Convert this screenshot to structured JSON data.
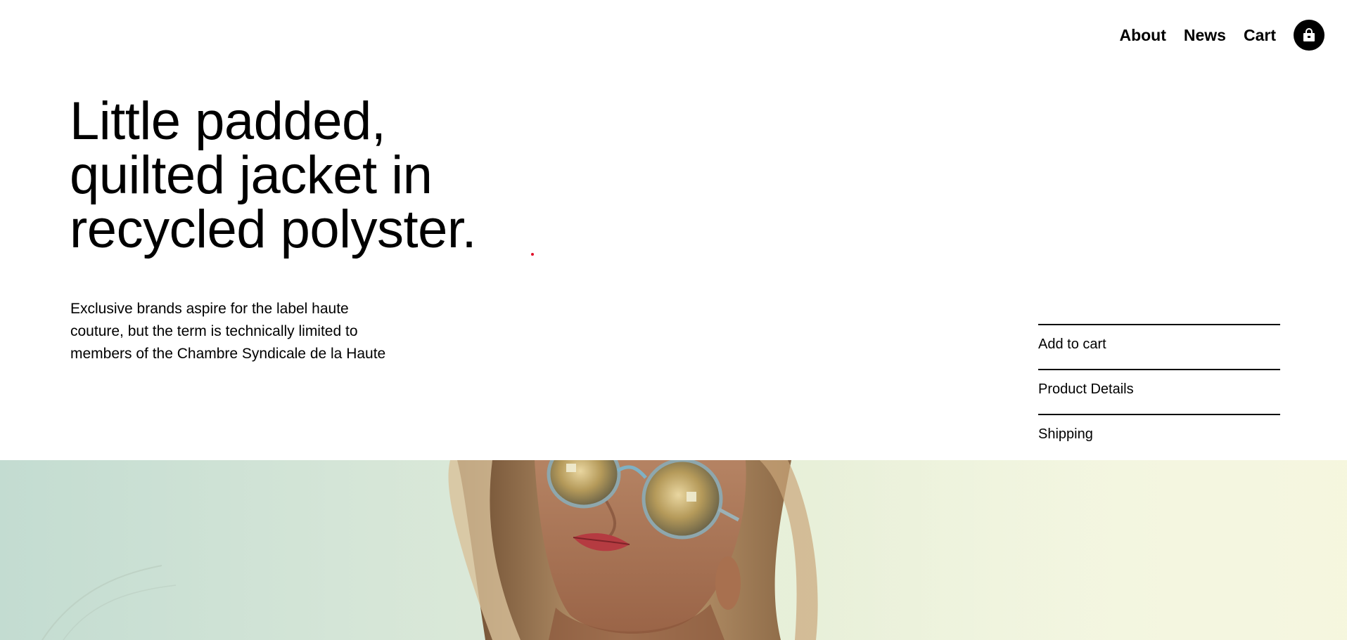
{
  "nav": {
    "items": [
      {
        "label": "About"
      },
      {
        "label": "News"
      },
      {
        "label": "Cart"
      }
    ],
    "bag_icon": "shopping-bag-icon"
  },
  "hero": {
    "title_lines": [
      "Little padded,",
      "quilted jacket in",
      "recycled polyster."
    ],
    "description_lines": [
      "Exclusive brands aspire for the label haute",
      "couture, but the term is technically limited to",
      "members of the Chambre Syndicale de la Haute"
    ]
  },
  "accordion": {
    "items": [
      {
        "label": "Add to cart"
      },
      {
        "label": "Product Details"
      },
      {
        "label": "Shipping"
      }
    ]
  },
  "colors": {
    "text": "#000000",
    "background": "#ffffff",
    "accent_dot": "#e0102a"
  }
}
